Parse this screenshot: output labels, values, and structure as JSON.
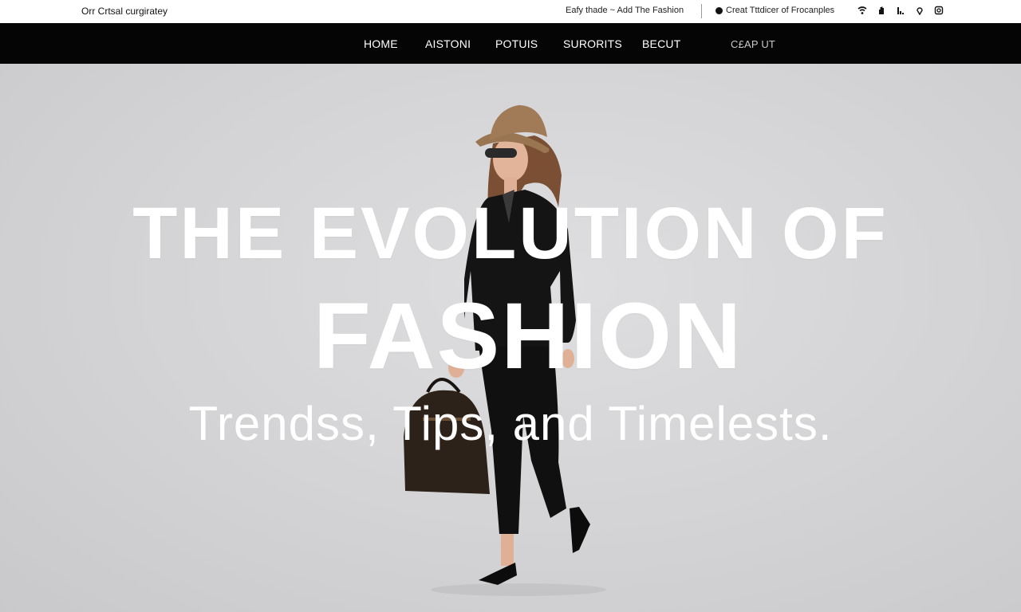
{
  "topbar": {
    "brand": "Orr Crtsal curgiratey",
    "promo": "Eafy thade ~ Add The Fashion",
    "contact": "Creat Tttdicer of Frocanples",
    "icons": [
      "wifi-icon",
      "hand-icon",
      "chart-icon",
      "location-pin-icon",
      "instagram-icon"
    ]
  },
  "nav": {
    "items": [
      "HOME",
      "AISTONI",
      "POTUIS",
      "SURORITS",
      "BECUT"
    ],
    "extra": "C£AP UT"
  },
  "hero": {
    "title_line1": "THE EVOLUTION OF",
    "title_line2": "FASHION",
    "tagline": "Trendss, Tips, and Timelests."
  },
  "colors": {
    "navbar_bg": "#050505",
    "topbar_bg": "#ffffff",
    "hero_bg": "#d6d6d8",
    "headline": "#ffffff"
  }
}
